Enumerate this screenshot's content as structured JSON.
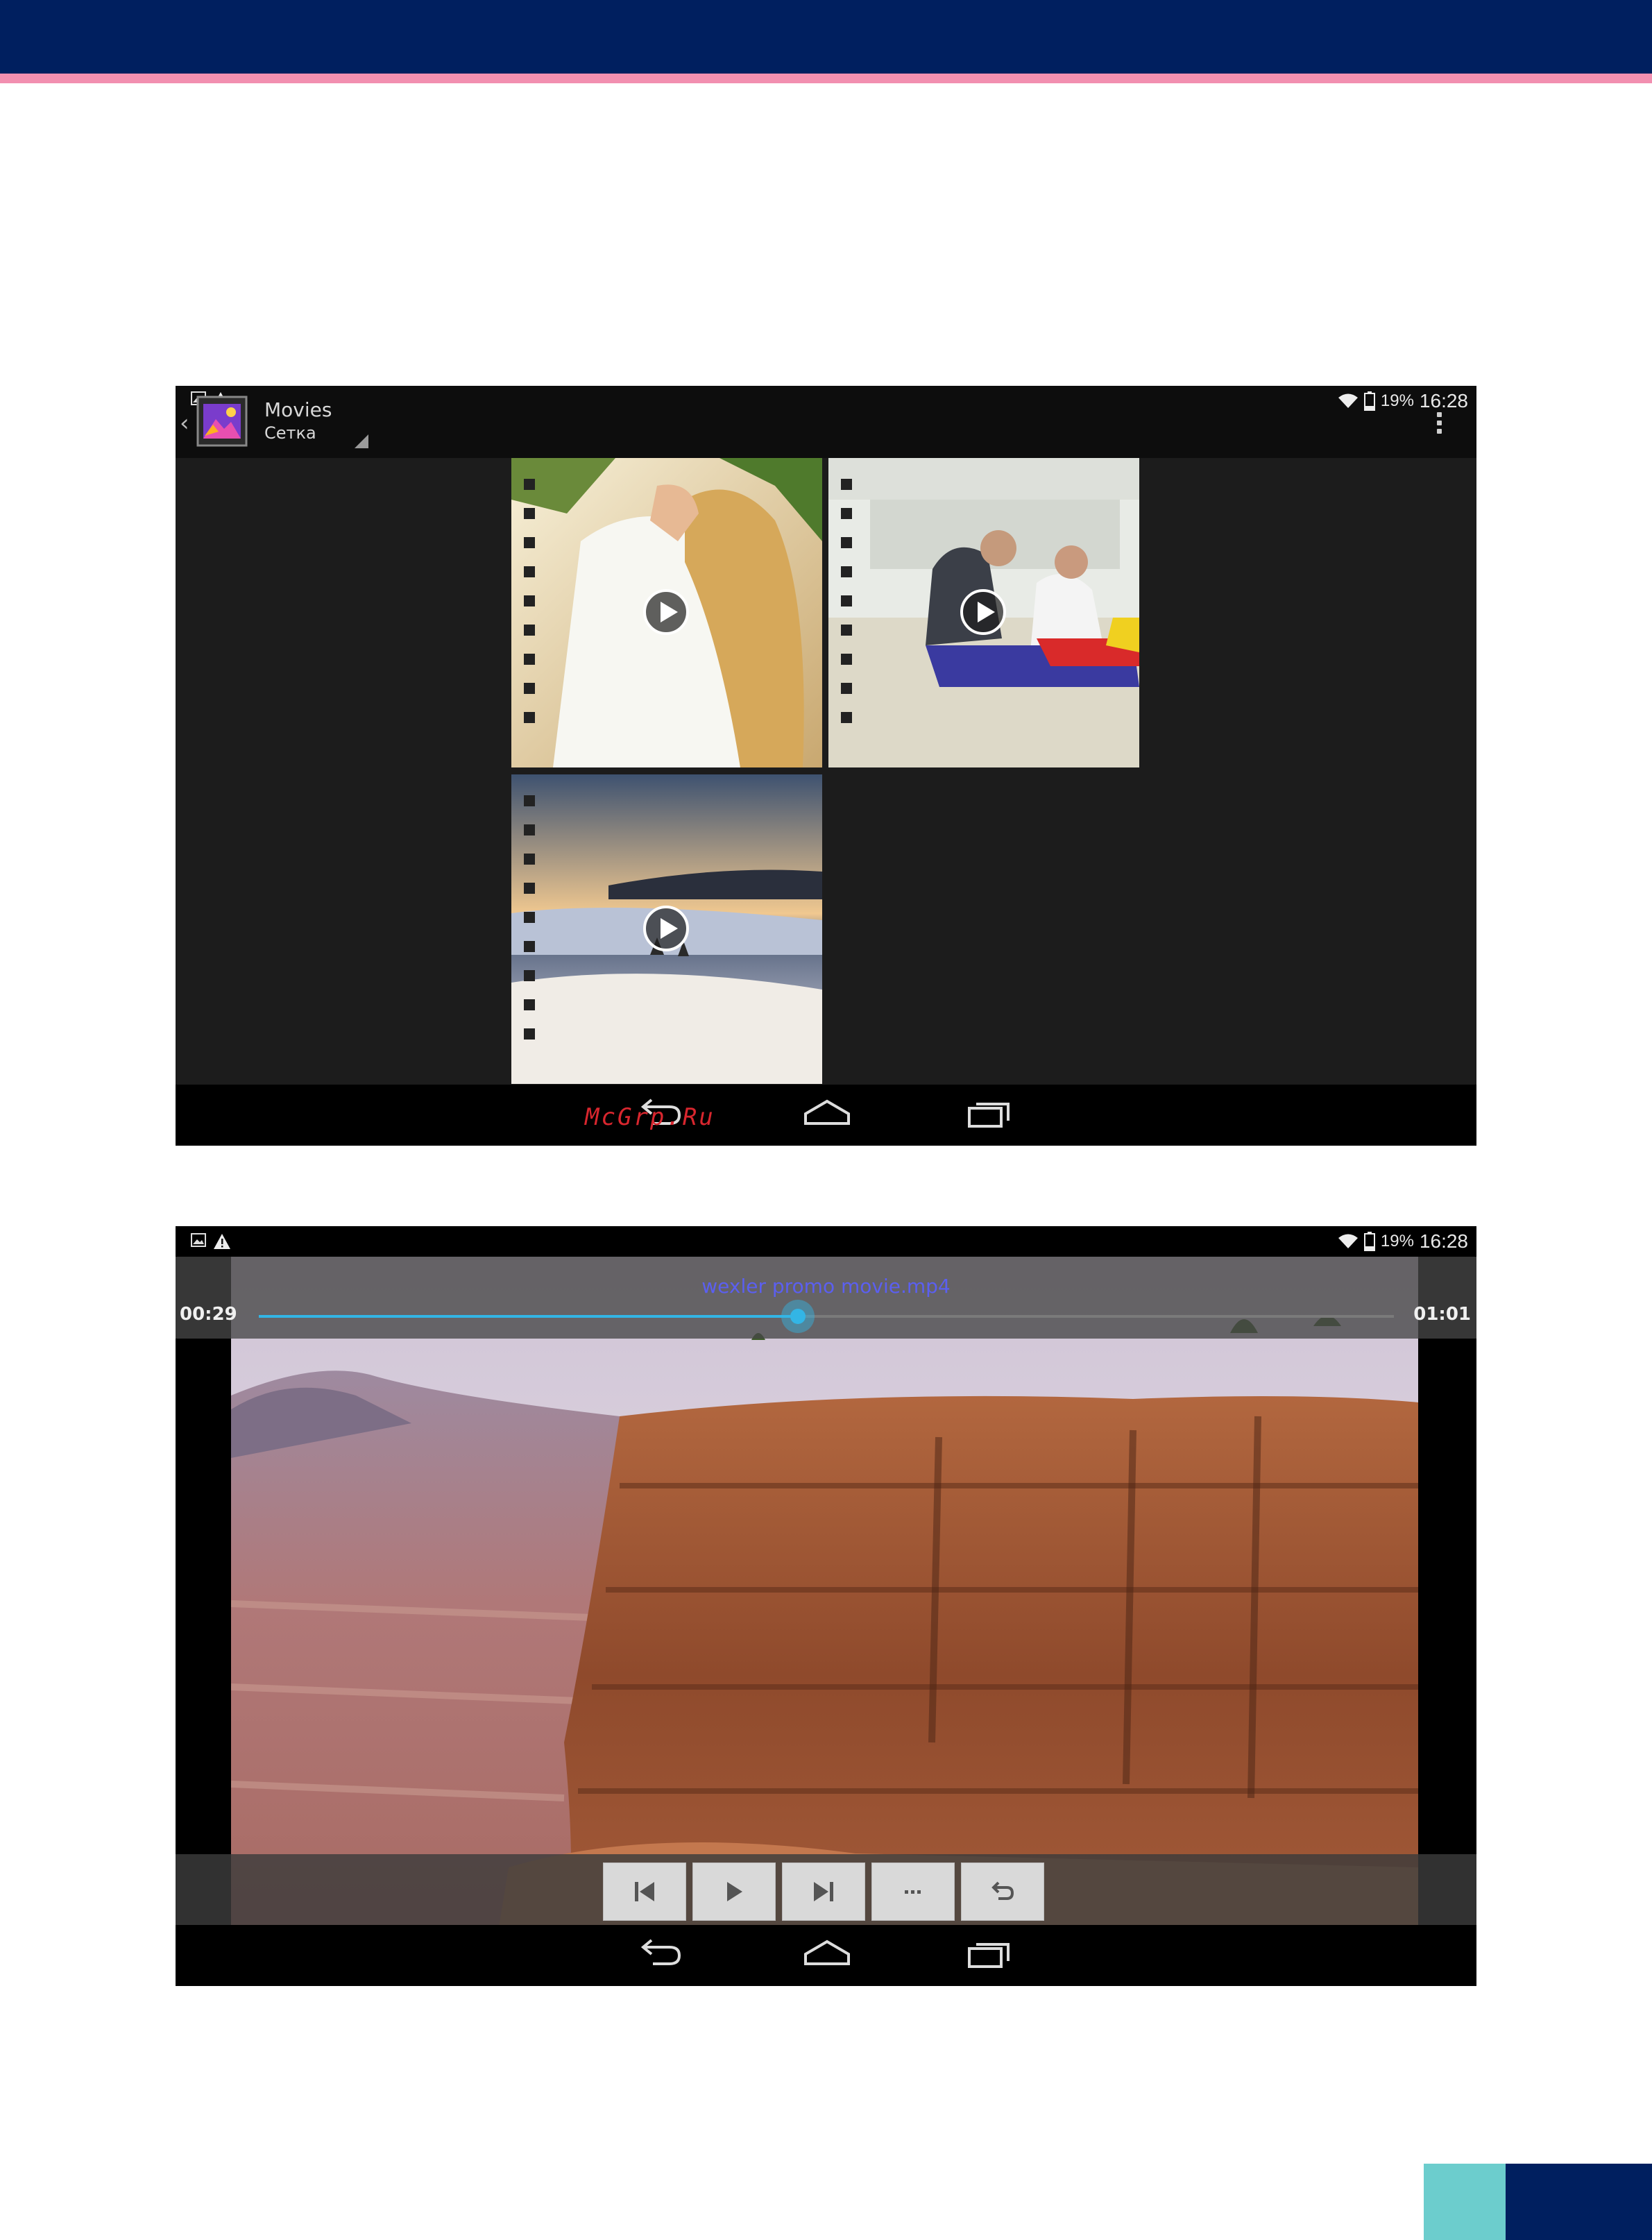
{
  "gallery": {
    "status_bar": {
      "battery_percent": "19%",
      "time": "16:28"
    },
    "action_bar": {
      "title": "Movies",
      "subtitle": "Сетка"
    },
    "thumbnails": [
      {
        "icon": "play-icon"
      },
      {
        "icon": "play-icon"
      },
      {
        "icon": "play-icon"
      }
    ]
  },
  "watermark": "McGrp.Ru",
  "player": {
    "status_bar": {
      "battery_percent": "19%",
      "time": "16:28"
    },
    "title": "wexler promo movie.mp4",
    "elapsed": "00:29",
    "duration": "01:01",
    "progress_fraction": 0.475,
    "controls": [
      "previous-icon",
      "play-icon",
      "next-icon",
      "more-icon",
      "repeat-icon"
    ]
  },
  "colors": {
    "accent": "#33b5e5",
    "header_band": "#001f5f",
    "pink_strip": "#f28fb0",
    "teal": "#6ccdcd"
  }
}
